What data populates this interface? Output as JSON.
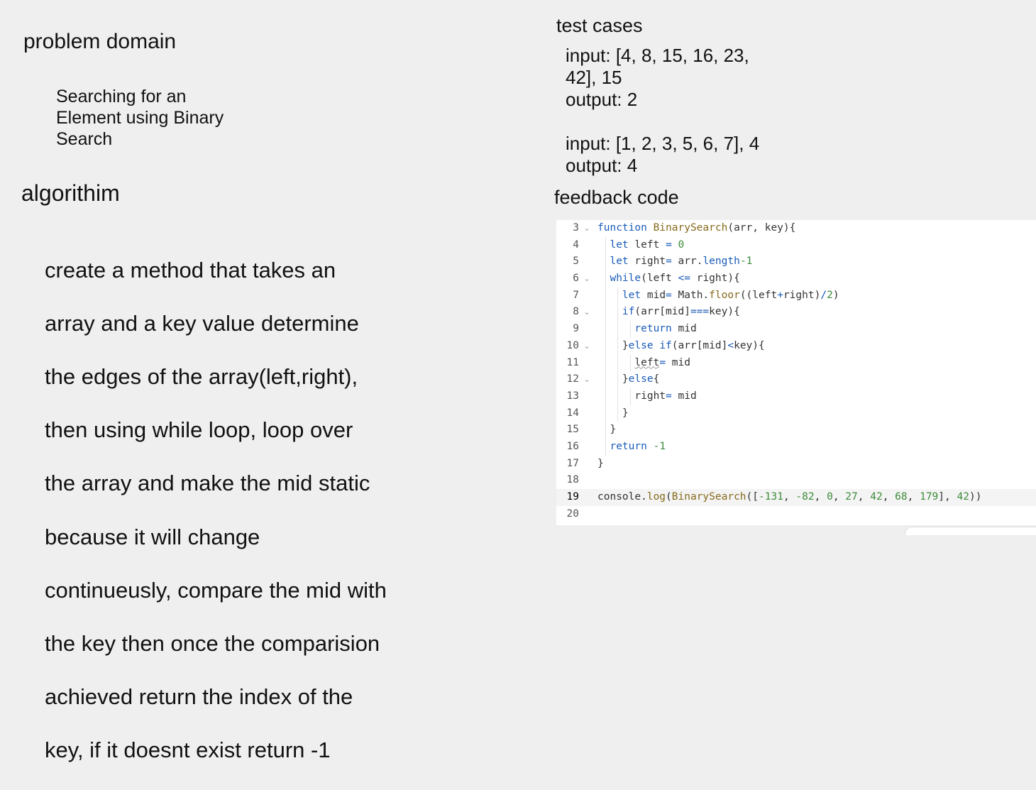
{
  "problem": {
    "heading": "problem domain",
    "lines": [
      "Searching for an",
      "Element using Binary",
      "Search"
    ]
  },
  "algorithm": {
    "heading": "algorithim",
    "lines": [
      "create a method that takes an",
      "array  and a key value determine",
      "the edges of the array(left,right),",
      "then using while loop, loop over",
      "the array and make the mid static",
      "because it will change",
      "continueusly, compare the mid with",
      "the key then once the comparision",
      "achieved return the index of the",
      "key, if it doesnt exist return -1"
    ]
  },
  "tests": {
    "heading": "test cases",
    "case1_input_line1": "input: [4, 8, 15, 16, 23,",
    "case1_input_line2": "42], 15",
    "case1_output": "output: 2",
    "case2_input": "input: [1, 2, 3, 5, 6, 7], 4",
    "case2_output": "output: 4"
  },
  "feedback": {
    "heading": "feedback code",
    "fold_icon": "chevron-down-icon",
    "lines": [
      {
        "n": "3",
        "fold": true,
        "code": "function BinarySearch(arr, key){"
      },
      {
        "n": "4",
        "fold": false,
        "code": "  let left = 0"
      },
      {
        "n": "5",
        "fold": false,
        "code": "  let right= arr.length-1"
      },
      {
        "n": "6",
        "fold": true,
        "code": "  while(left <= right){"
      },
      {
        "n": "7",
        "fold": false,
        "code": "    let mid= Math.floor((left+right)/2)"
      },
      {
        "n": "8",
        "fold": true,
        "code": "    if(arr[mid]===key){"
      },
      {
        "n": "9",
        "fold": false,
        "code": "      return mid"
      },
      {
        "n": "10",
        "fold": true,
        "code": "    }else if(arr[mid]<key){"
      },
      {
        "n": "11",
        "fold": false,
        "code": "      left= mid"
      },
      {
        "n": "12",
        "fold": true,
        "code": "    }else{"
      },
      {
        "n": "13",
        "fold": false,
        "code": "      right= mid"
      },
      {
        "n": "14",
        "fold": false,
        "code": "    }"
      },
      {
        "n": "15",
        "fold": false,
        "code": "  }"
      },
      {
        "n": "16",
        "fold": false,
        "code": "  return -1"
      },
      {
        "n": "17",
        "fold": false,
        "code": "}"
      },
      {
        "n": "18",
        "fold": false,
        "code": ""
      },
      {
        "n": "19",
        "fold": false,
        "code": "console.log(BinarySearch([-131, -82, 0, 27, 42, 68, 179], 42))"
      },
      {
        "n": "20",
        "fold": false,
        "code": ""
      }
    ]
  },
  "colors": {
    "keyword": "#1a5bb8",
    "function": "#85691a",
    "number": "#3d8b3a",
    "background": "#efefef"
  }
}
